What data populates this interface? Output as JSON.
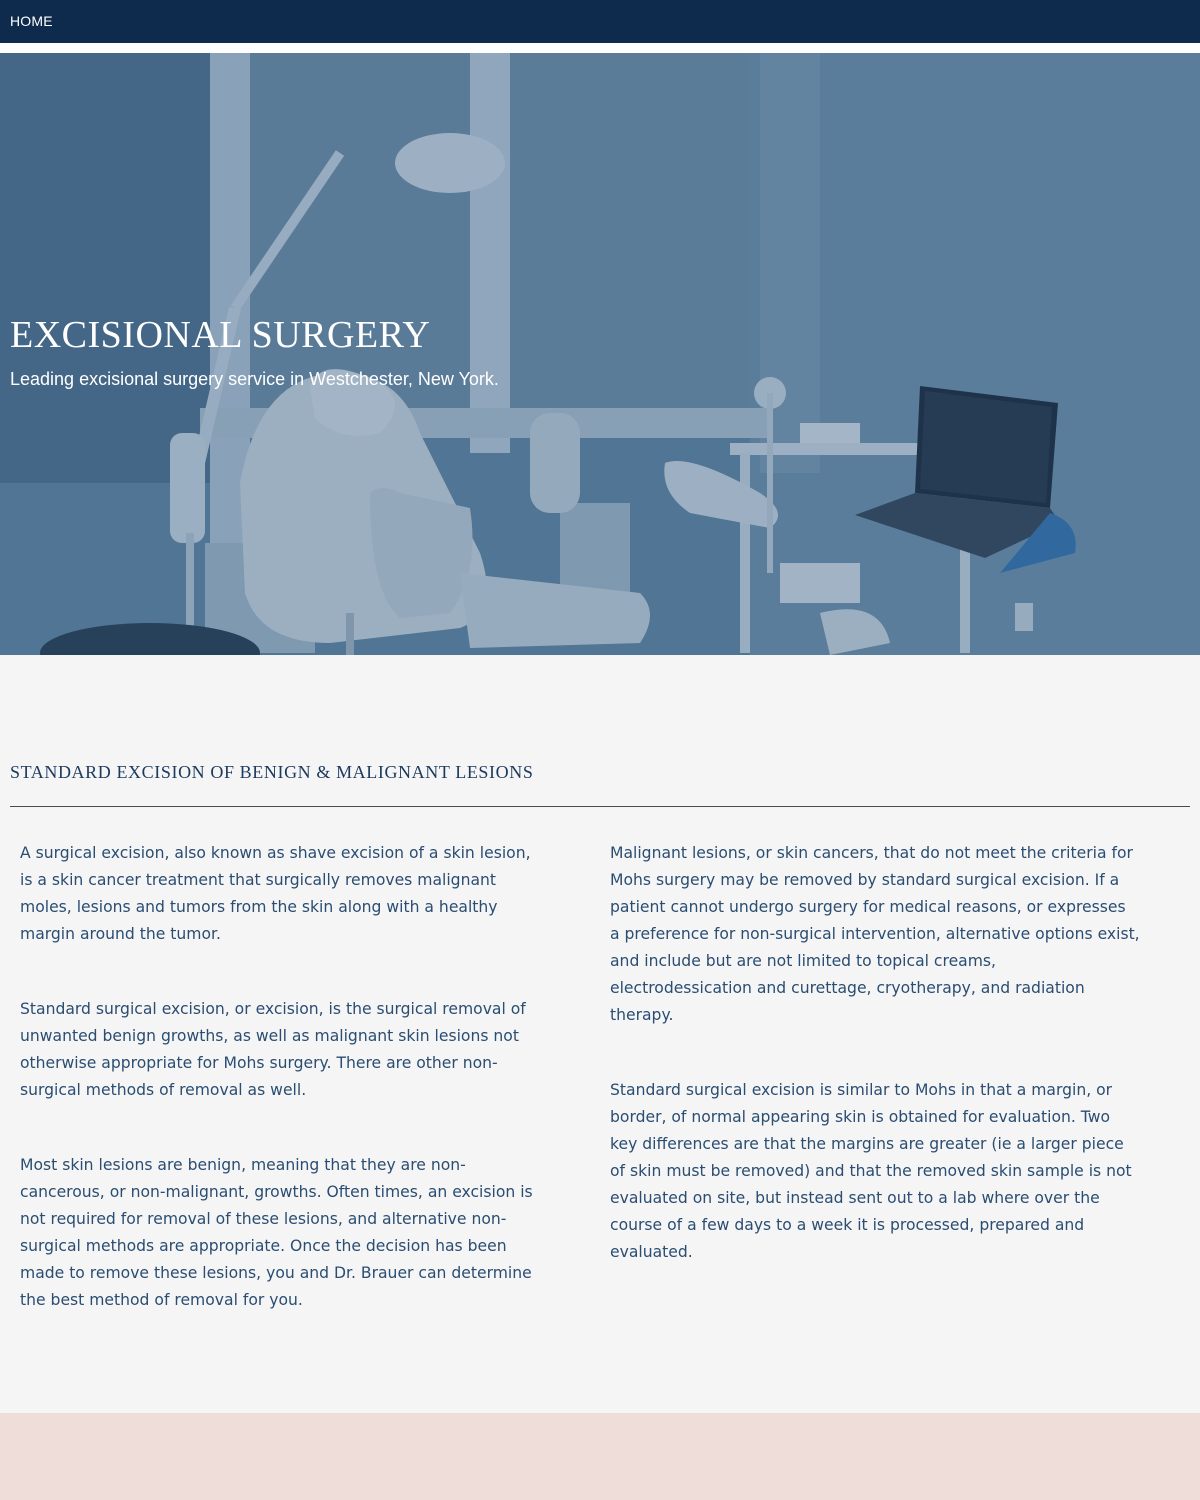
{
  "nav": {
    "home_label": "HOME"
  },
  "hero": {
    "title": "EXCISIONAL SURGERY",
    "subtitle": "Leading excisional surgery service in Westchester, New York."
  },
  "section": {
    "heading": "STANDARD EXCISION OF BENIGN & MALIGNANT LESIONS",
    "left_paragraphs": [
      "A surgical excision, also known as shave excision of a skin lesion, is a skin cancer treatment that surgically removes malignant moles, lesions and tumors from the skin along with a healthy margin around the tumor.",
      "Standard surgical excision, or excision, is the surgical removal of unwanted benign growths, as well as malignant skin lesions not otherwise appropriate for Mohs surgery.  There are other non-surgical methods of removal as well.",
      "Most skin lesions are benign, meaning that they are non-cancerous, or non-malignant, growths.  Often times, an excision is not required for removal of these lesions, and alternative non-surgical methods are appropriate.  Once the decision has been made to remove these lesions, you and Dr. Brauer can determine the best method of removal for you."
    ],
    "right_paragraphs": [
      "Malignant lesions, or skin cancers, that do not meet the criteria for Mohs surgery may be removed by standard surgical excision.  If a patient cannot undergo surgery for medical reasons, or expresses a preference for non-surgical intervention, alternative options exist, and include but are not limited to topical creams, electrodessication and curettage, cryotherapy, and radiation therapy.",
      "Standard surgical excision is similar to Mohs in that a margin, or border, of normal appearing skin is obtained for evaluation.  Two key differences are that the margins are greater (ie a larger piece of skin must be removed) and that the removed skin sample is not evaluated on site, but instead sent out to a lab where over the course of a few days to a week it is processed, prepared and evaluated."
    ]
  },
  "colors": {
    "nav_bg": "#0e2a4c",
    "heading": "#1b3a5e",
    "body_text": "#2a4d72",
    "page_bg": "#f5f5f5",
    "footer_band": "#eeddd8"
  }
}
